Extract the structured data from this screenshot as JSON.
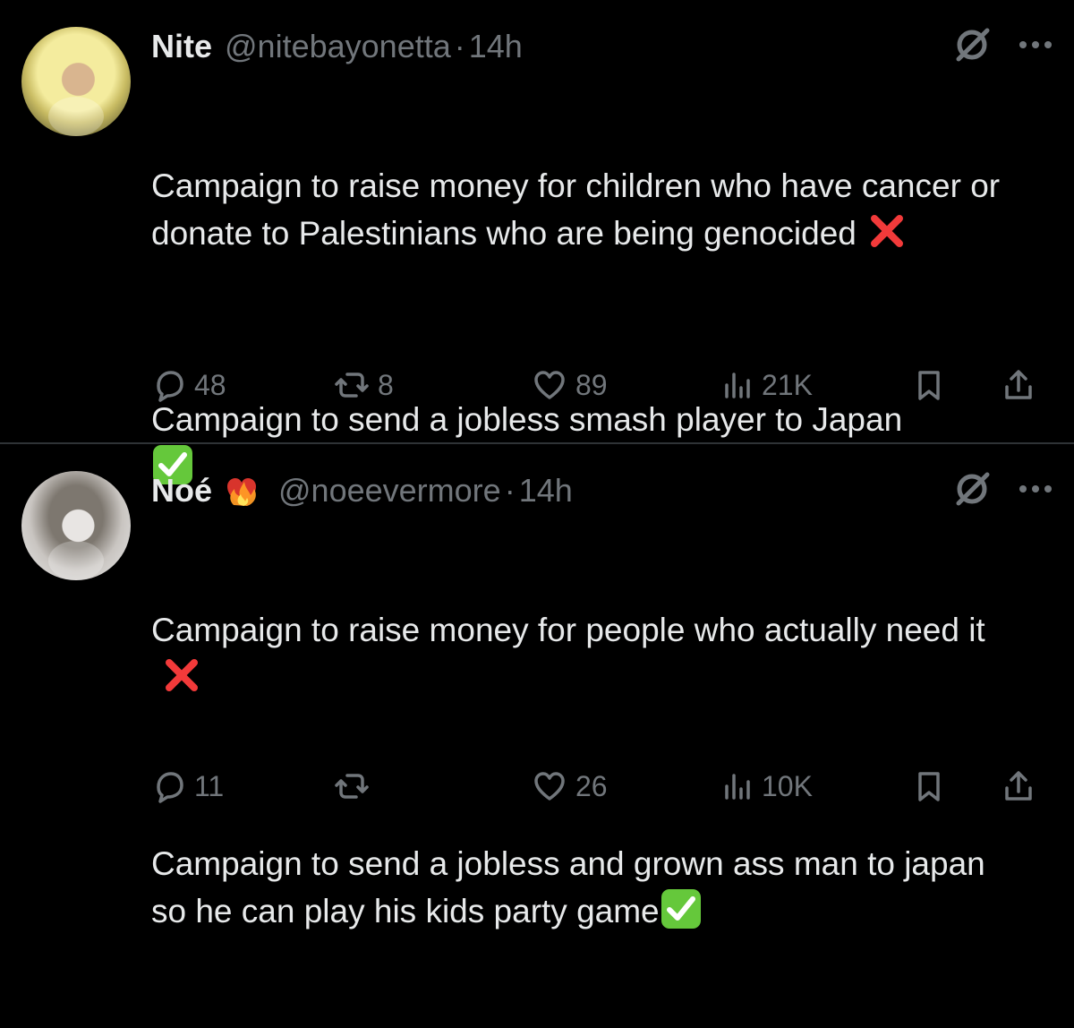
{
  "posts": [
    {
      "display_name": "Nite",
      "handle": "@nitebayonetta",
      "separator": "·",
      "time": "14h",
      "body": [
        "Campaign to raise money for children who have cancer or donate to Palestinians who are being genocided",
        "Campaign to send a jobless smash player to Japan"
      ],
      "stats": {
        "replies": "48",
        "retweets": "8",
        "likes": "89",
        "views": "21K"
      },
      "icons": {
        "avatar": "avatar",
        "grok": "grok-icon",
        "more": "more-icon",
        "reply": "reply-icon",
        "retweet": "retweet-icon",
        "like": "heart-icon",
        "views": "views-icon",
        "bookmark": "bookmark-icon",
        "share": "share-icon"
      }
    },
    {
      "display_name": "Noé",
      "handle": "@noeevermore",
      "separator": "·",
      "time": "14h",
      "body": [
        "Campaign to raise money for people who actually need it",
        "Campaign to send a jobless and grown ass man to japan so he can play his kids party game"
      ],
      "stats": {
        "replies": "11",
        "retweets": "",
        "likes": "26",
        "views": "10K"
      },
      "icons": {
        "avatar": "avatar",
        "badge": "heart-on-fire-emoji",
        "grok": "grok-icon",
        "more": "more-icon",
        "reply": "reply-icon",
        "retweet": "retweet-icon",
        "like": "heart-icon",
        "views": "views-icon",
        "bookmark": "bookmark-icon",
        "share": "share-icon"
      }
    }
  ],
  "colors": {
    "background": "#000000",
    "text": "#e7e9ea",
    "muted": "#71767b",
    "divider": "#2f3336",
    "red_x": "#f23a3a",
    "green_check": "#65c83b"
  }
}
